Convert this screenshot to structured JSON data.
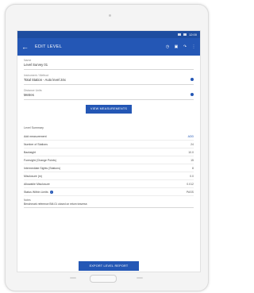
{
  "statusbar": {
    "time": "12:00"
  },
  "appbar": {
    "back_icon": "arrow-left-icon",
    "title": "EDIT LEVEL",
    "actions": [
      "history-icon",
      "camera-icon",
      "share-icon",
      "more-icon"
    ]
  },
  "form": {
    "fields": [
      {
        "label": "Name",
        "value": "Level Survey 01"
      },
      {
        "label": "Instrument / Method",
        "value": "Total Station - Auto level 24x"
      },
      {
        "label": "Distance Units",
        "value": "Metres"
      }
    ],
    "main_button": "VIEW MEASUREMENTS"
  },
  "summary": {
    "title": "Level Summary",
    "rows": [
      {
        "key": "Add measurement",
        "value": "ADD",
        "link": true
      },
      {
        "key": "Number of Stations",
        "value": "24"
      },
      {
        "key": "Backsight",
        "value": "10.0"
      },
      {
        "key": "Foresight (Change Points)",
        "value": "15"
      },
      {
        "key": "Intermediate Sights (Stations)",
        "value": "8"
      },
      {
        "key": "Misclosure (m)",
        "value": "0.0"
      },
      {
        "key": "Allowable Misclosure",
        "value": "0.012"
      },
      {
        "key": "Status Within Limits",
        "value": "PASS",
        "info": true
      }
    ],
    "note_label": "Notes",
    "note_value": "Benchmark reference BM-01 closed on return traverse."
  },
  "bottom_button": "EXPORT LEVEL REPORT",
  "colors": {
    "primary": "#2457b5",
    "statusbar": "#1e4da0"
  }
}
